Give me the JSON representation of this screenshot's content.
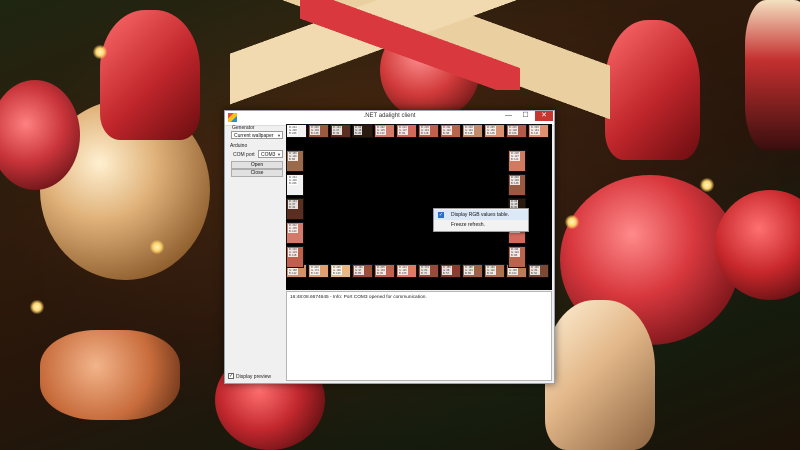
{
  "window": {
    "title": ".NET adalight client",
    "controls": {
      "minimize": "—",
      "maximize": "☐",
      "close": "✕"
    },
    "titlebar_color": "#ffffff"
  },
  "sidebar": {
    "generator_label": "Generator",
    "generator_value": "Current wallpaper",
    "arduino_label": "Arduino",
    "com_port_label": "COM port",
    "com_port_value": "COM3",
    "open_button": "Open",
    "close_button": "Close",
    "display_preview_label": "Display preview",
    "display_preview_checked": true
  },
  "preview": {
    "background": "#000000",
    "cells": [
      {
        "color": "#f2f2f2",
        "lbl": "R: 224\nG: 230\nB: 226"
      },
      {
        "color": "#9a5a40",
        "lbl": "R: 200\nG: 139\nB: 128"
      },
      {
        "color": "#5a2e20",
        "lbl": "R: 134\nG: 67\nB: 49"
      },
      {
        "color": "#2a1a10",
        "lbl": "R: 66\nG: 45\nB: 30"
      },
      {
        "color": "#d47a6a",
        "lbl": "R: 232\nG: 135\nB: 123"
      },
      {
        "color": "#d26a5c",
        "lbl": "R: 213\nG: 107\nB: 99"
      },
      {
        "color": "#c0604c",
        "lbl": "R: 219\nG: 133\nB: 118"
      },
      {
        "color": "#b8654c",
        "lbl": "R: 211\nG: 122\nB: 98"
      },
      {
        "color": "#c48a6c",
        "lbl": "R: 218\nG: 149\nB: 118"
      },
      {
        "color": "#d89070",
        "lbl": "R: 235\nG: 160\nB: 128"
      },
      {
        "color": "#b2594a",
        "lbl": "R: 210\nG: 128\nB: 106"
      },
      {
        "color": "#e09070",
        "lbl": "R: 239\nG: 164\nB: 131"
      },
      {
        "color": "#d89066",
        "lbl": "R: 232\nG: 158\nB: 122"
      },
      {
        "color": "#e0a070",
        "lbl": "R: 240\nG: 174\nB: 130"
      },
      {
        "color": "#e8b884",
        "lbl": "R: 245\nG: 190\nB: 140"
      },
      {
        "color": "#a04c3c",
        "lbl": "R: 191\nG: 97\nB: 85"
      },
      {
        "color": "#c06050",
        "lbl": "R: 205\nG: 104\nB: 90"
      },
      {
        "color": "#e07a66",
        "lbl": "R: 223\nG: 115\nB: 105"
      },
      {
        "color": "#9a4a3a",
        "lbl": "R: 174\nG: 82\nB: 70"
      },
      {
        "color": "#8a3c30",
        "lbl": "R: 156\nG: 68\nB: 57"
      },
      {
        "color": "#a06048",
        "lbl": "R: 188\nG: 101\nB: 80"
      },
      {
        "color": "#b07050",
        "lbl": "R: 199\nG: 119\nB: 92"
      },
      {
        "color": "#c07a56",
        "lbl": "R: 212\nG: 138\nB: 104"
      },
      {
        "color": "#7a4a36",
        "lbl": "R: 136\nG: 84\nB: 60"
      },
      {
        "color": "#9a6a4a",
        "lbl": "R: 166\nG: 116\nB: 86"
      },
      {
        "color": "#d07a60",
        "lbl": "R: 218\nG: 137\nB: 113"
      }
    ]
  },
  "log": {
    "line": "16:48:08.6674645 - Info: Port COM3 opened for communication."
  },
  "context_menu": {
    "items": [
      {
        "label": "Display RGB values table.",
        "checked": true
      },
      {
        "label": "Freeze refresh.",
        "checked": false
      }
    ]
  },
  "wallpaper": {
    "palette": [
      "#c8343a",
      "#e9c58a",
      "#2b3a18",
      "#f1d9b0",
      "#7a1d1d"
    ]
  }
}
